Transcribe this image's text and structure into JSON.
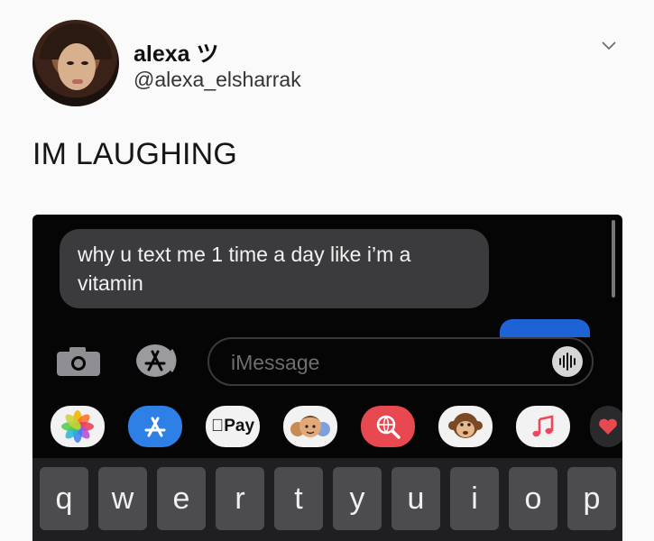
{
  "tweet": {
    "author_name": "alexa ツ",
    "author_handle": "@alexa_elsharrak",
    "text": "IM LAUGHING"
  },
  "message": {
    "incoming_text": "why u text me 1 time a day like i’m a vitamin"
  },
  "composer": {
    "placeholder": "iMessage"
  },
  "app_tray": {
    "apple_pay_label": "Pay",
    "icons": [
      "photos-icon",
      "app-store-icon",
      "apple-pay-icon",
      "memoji-icon",
      "web-search-icon",
      "monkey-animoji-icon",
      "music-icon",
      "heart-icon"
    ]
  },
  "keyboard": {
    "row1": [
      "q",
      "w",
      "e",
      "r",
      "t",
      "y",
      "u",
      "i",
      "o",
      "p"
    ]
  },
  "colors": {
    "incoming_bubble": "#3b3b3d",
    "sent_bubble": "#1d63d6",
    "keyboard_bg": "#1f1f21"
  }
}
